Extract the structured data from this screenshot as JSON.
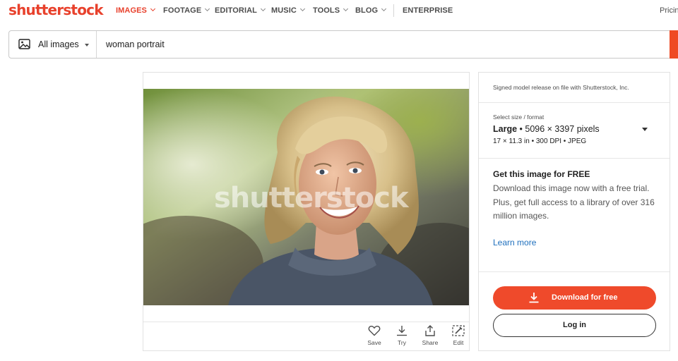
{
  "header": {
    "logo": "shutterstock",
    "nav": [
      {
        "label": "IMAGES",
        "active": true
      },
      {
        "label": "FOOTAGE"
      },
      {
        "label": "EDITORIAL"
      },
      {
        "label": "MUSIC"
      },
      {
        "label": "TOOLS"
      },
      {
        "label": "BLOG"
      }
    ],
    "enterprise": "ENTERPRISE",
    "pricing": "Pricin"
  },
  "search": {
    "type_label": "All images",
    "query": "woman portrait"
  },
  "image": {
    "watermark": "shutterstock",
    "actions": [
      {
        "label": "Save",
        "icon": "heart-icon"
      },
      {
        "label": "Try",
        "icon": "download-icon"
      },
      {
        "label": "Share",
        "icon": "share-icon"
      },
      {
        "label": "Edit",
        "icon": "edit-icon"
      }
    ]
  },
  "panel": {
    "release_note": "Signed model release on file with Shutterstock, Inc.",
    "size_label": "Select size / format",
    "size_name": "Large",
    "size_pixels": "• 5096 × 3397 pixels",
    "size_details": "17 × 11.3 in • 300 DPI • JPEG",
    "free_title": "Get this image for FREE",
    "free_body": "Download this image now with a free trial.\nPlus, get full access to a library of over 316 million images.",
    "learn_more": "Learn more",
    "download_label": "Download for free",
    "login_label": "Log in"
  },
  "colors": {
    "brand": "#e8412c",
    "cta": "#ef4a2b",
    "link": "#1e6fbd"
  }
}
